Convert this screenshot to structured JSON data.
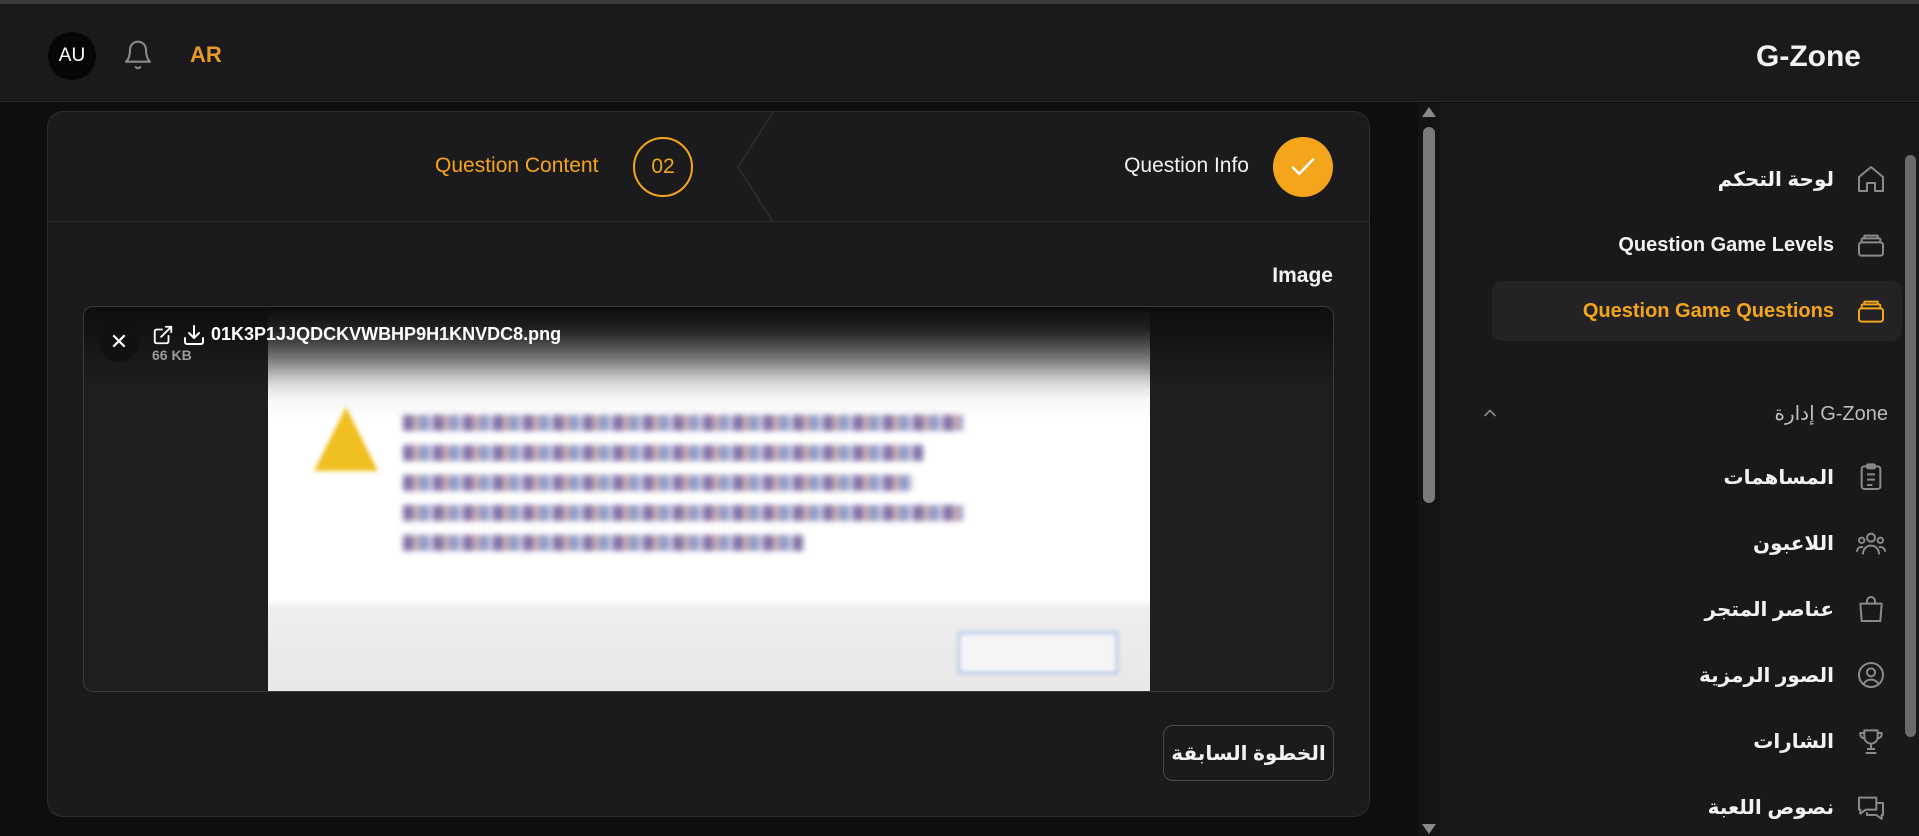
{
  "header": {
    "avatar_initials": "AU",
    "language": "AR",
    "brand": "G-Zone"
  },
  "stepper": {
    "steps": [
      {
        "label": "Question Info",
        "state": "done"
      },
      {
        "label": "Question Content",
        "number": "02",
        "state": "active"
      }
    ]
  },
  "form": {
    "image_label": "Image",
    "file": {
      "name": "01K3P1JJQDCKVWBHP9H1KNVDC8.png",
      "size": "66 KB"
    },
    "prev_button": "الخطوة السابقة"
  },
  "sidebar": {
    "items": [
      {
        "label": "لوحة التحكم",
        "icon": "home-icon",
        "active": false
      },
      {
        "label": "Question Game Levels",
        "icon": "layers-icon",
        "active": false
      },
      {
        "label": "Question Game Questions",
        "icon": "layers-icon",
        "active": true
      }
    ],
    "section": {
      "label": "إدارة G-Zone",
      "items": [
        {
          "label": "المساهمات",
          "icon": "clipboard-icon"
        },
        {
          "label": "اللاعبون",
          "icon": "users-icon"
        },
        {
          "label": "عناصر المتجر",
          "icon": "shopping-bag-icon"
        },
        {
          "label": "الصور الرمزية",
          "icon": "user-circle-icon"
        },
        {
          "label": "الشارات",
          "icon": "trophy-icon"
        },
        {
          "label": "نصوص اللعبة",
          "icon": "chat-icon"
        }
      ]
    }
  },
  "colors": {
    "accent": "#f4a51c",
    "lang": "#e79a2a",
    "background": "#0e0e0f",
    "panel": "#1b1b1d"
  }
}
